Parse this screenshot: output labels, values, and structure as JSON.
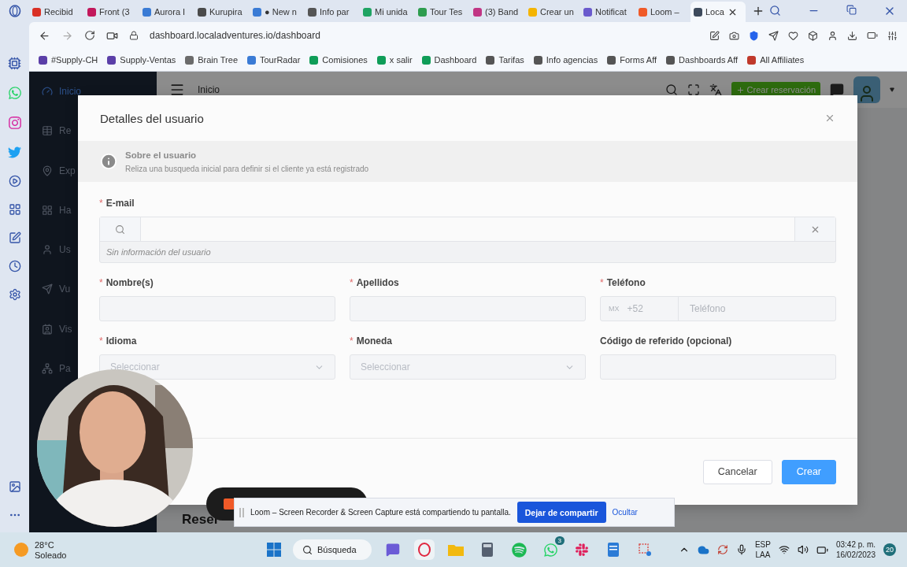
{
  "browser": {
    "tabs": [
      {
        "label": "Recibid",
        "selected": false,
        "color": "#d93025"
      },
      {
        "label": "Front (3",
        "selected": false,
        "color": "#c2185b"
      },
      {
        "label": "Aurora I",
        "selected": false,
        "color": "#3a7bd5"
      },
      {
        "label": "Kurupira",
        "selected": false,
        "color": "#4a4a4a"
      },
      {
        "label": "● New n",
        "selected": false,
        "color": "#3a7bd5"
      },
      {
        "label": "Info par",
        "selected": false,
        "color": "#555555"
      },
      {
        "label": "Mi unida",
        "selected": false,
        "color": "#1fa463"
      },
      {
        "label": "Tour Tes",
        "selected": false,
        "color": "#2e9d4f"
      },
      {
        "label": "(3) Band",
        "selected": false,
        "color": "#c13584"
      },
      {
        "label": "Crear un",
        "selected": false,
        "color": "#f4b400"
      },
      {
        "label": "Notificat",
        "selected": false,
        "color": "#6a5acd"
      },
      {
        "label": "Loom –",
        "selected": false,
        "color": "#f05a28"
      },
      {
        "label": "Loca",
        "selected": true,
        "color": "#3d4a5c"
      }
    ],
    "url": "dashboard.localadventures.io/dashboard",
    "bookmarks": [
      {
        "label": "#Supply-CH",
        "color": "#5b3fa8"
      },
      {
        "label": "Supply-Ventas",
        "color": "#5b3fa8"
      },
      {
        "label": "Brain Tree",
        "color": "#6b6b6b"
      },
      {
        "label": "TourRadar",
        "color": "#3a7bd5"
      },
      {
        "label": "Comisiones",
        "color": "#0f9d58"
      },
      {
        "label": "x salir",
        "color": "#0f9d58"
      },
      {
        "label": "Dashboard",
        "color": "#0f9d58"
      },
      {
        "label": "Tarifas",
        "color": "#555555"
      },
      {
        "label": "Info agencias",
        "color": "#555555"
      },
      {
        "label": "Forms Aff",
        "color": "#555555"
      },
      {
        "label": "Dashboards Aff",
        "color": "#555555"
      },
      {
        "label": "All Affiliates",
        "color": "#c0392b"
      }
    ]
  },
  "app": {
    "nav": [
      {
        "label": "Inicio",
        "selected": true
      },
      {
        "label": "Re",
        "selected": false
      },
      {
        "label": "Exp",
        "selected": false
      },
      {
        "label": "Ha",
        "selected": false
      },
      {
        "label": "Us",
        "selected": false
      },
      {
        "label": "Vu",
        "selected": false
      },
      {
        "label": "Vis",
        "selected": false
      },
      {
        "label": "Pa",
        "selected": false
      }
    ],
    "breadcrumb": "Inicio",
    "create_button": "Crear reservación",
    "section_heading": "Reser"
  },
  "dialog": {
    "title": "Detalles del usuario",
    "required_mark": "*",
    "info_title": "Sobre el usuario",
    "info_text": "Reliza una busqueda inicial para definir si el cliente ya está registrado",
    "email": {
      "label": "E-mail",
      "required": true,
      "hint": "Sin información del usuario"
    },
    "rows": [
      [
        {
          "label": "Nombre(s)",
          "required": true,
          "kind": "text"
        },
        {
          "label": "Apellidos",
          "required": true,
          "kind": "text"
        },
        {
          "label": "Teléfono",
          "required": true,
          "kind": "phone",
          "country": "MX",
          "prefix": "+52",
          "placeholder": "Teléfono"
        }
      ],
      [
        {
          "label": "Idioma",
          "required": true,
          "kind": "select",
          "placeholder": "Seleccionar"
        },
        {
          "label": "Moneda",
          "required": true,
          "kind": "select",
          "placeholder": "Seleccionar"
        },
        {
          "label": "Código de referido (opcional)",
          "required": false,
          "kind": "text"
        }
      ]
    ],
    "cancel_button": "Cancelar",
    "create_button": "Crear"
  },
  "share_banner": {
    "message": "Loom – Screen Recorder & Screen Capture está compartiendo tu pantalla.",
    "stop_button": "Dejar de compartir",
    "hide_link": "Ocultar"
  },
  "taskbar": {
    "temperature": "28°C",
    "weather": "Soleado",
    "search": "Búsqueda",
    "whatsapp_badge": "3",
    "language": "ESP",
    "layout": "LAA",
    "time": "03:42 p. m.",
    "date": "16/02/2023",
    "notifications": "20"
  }
}
